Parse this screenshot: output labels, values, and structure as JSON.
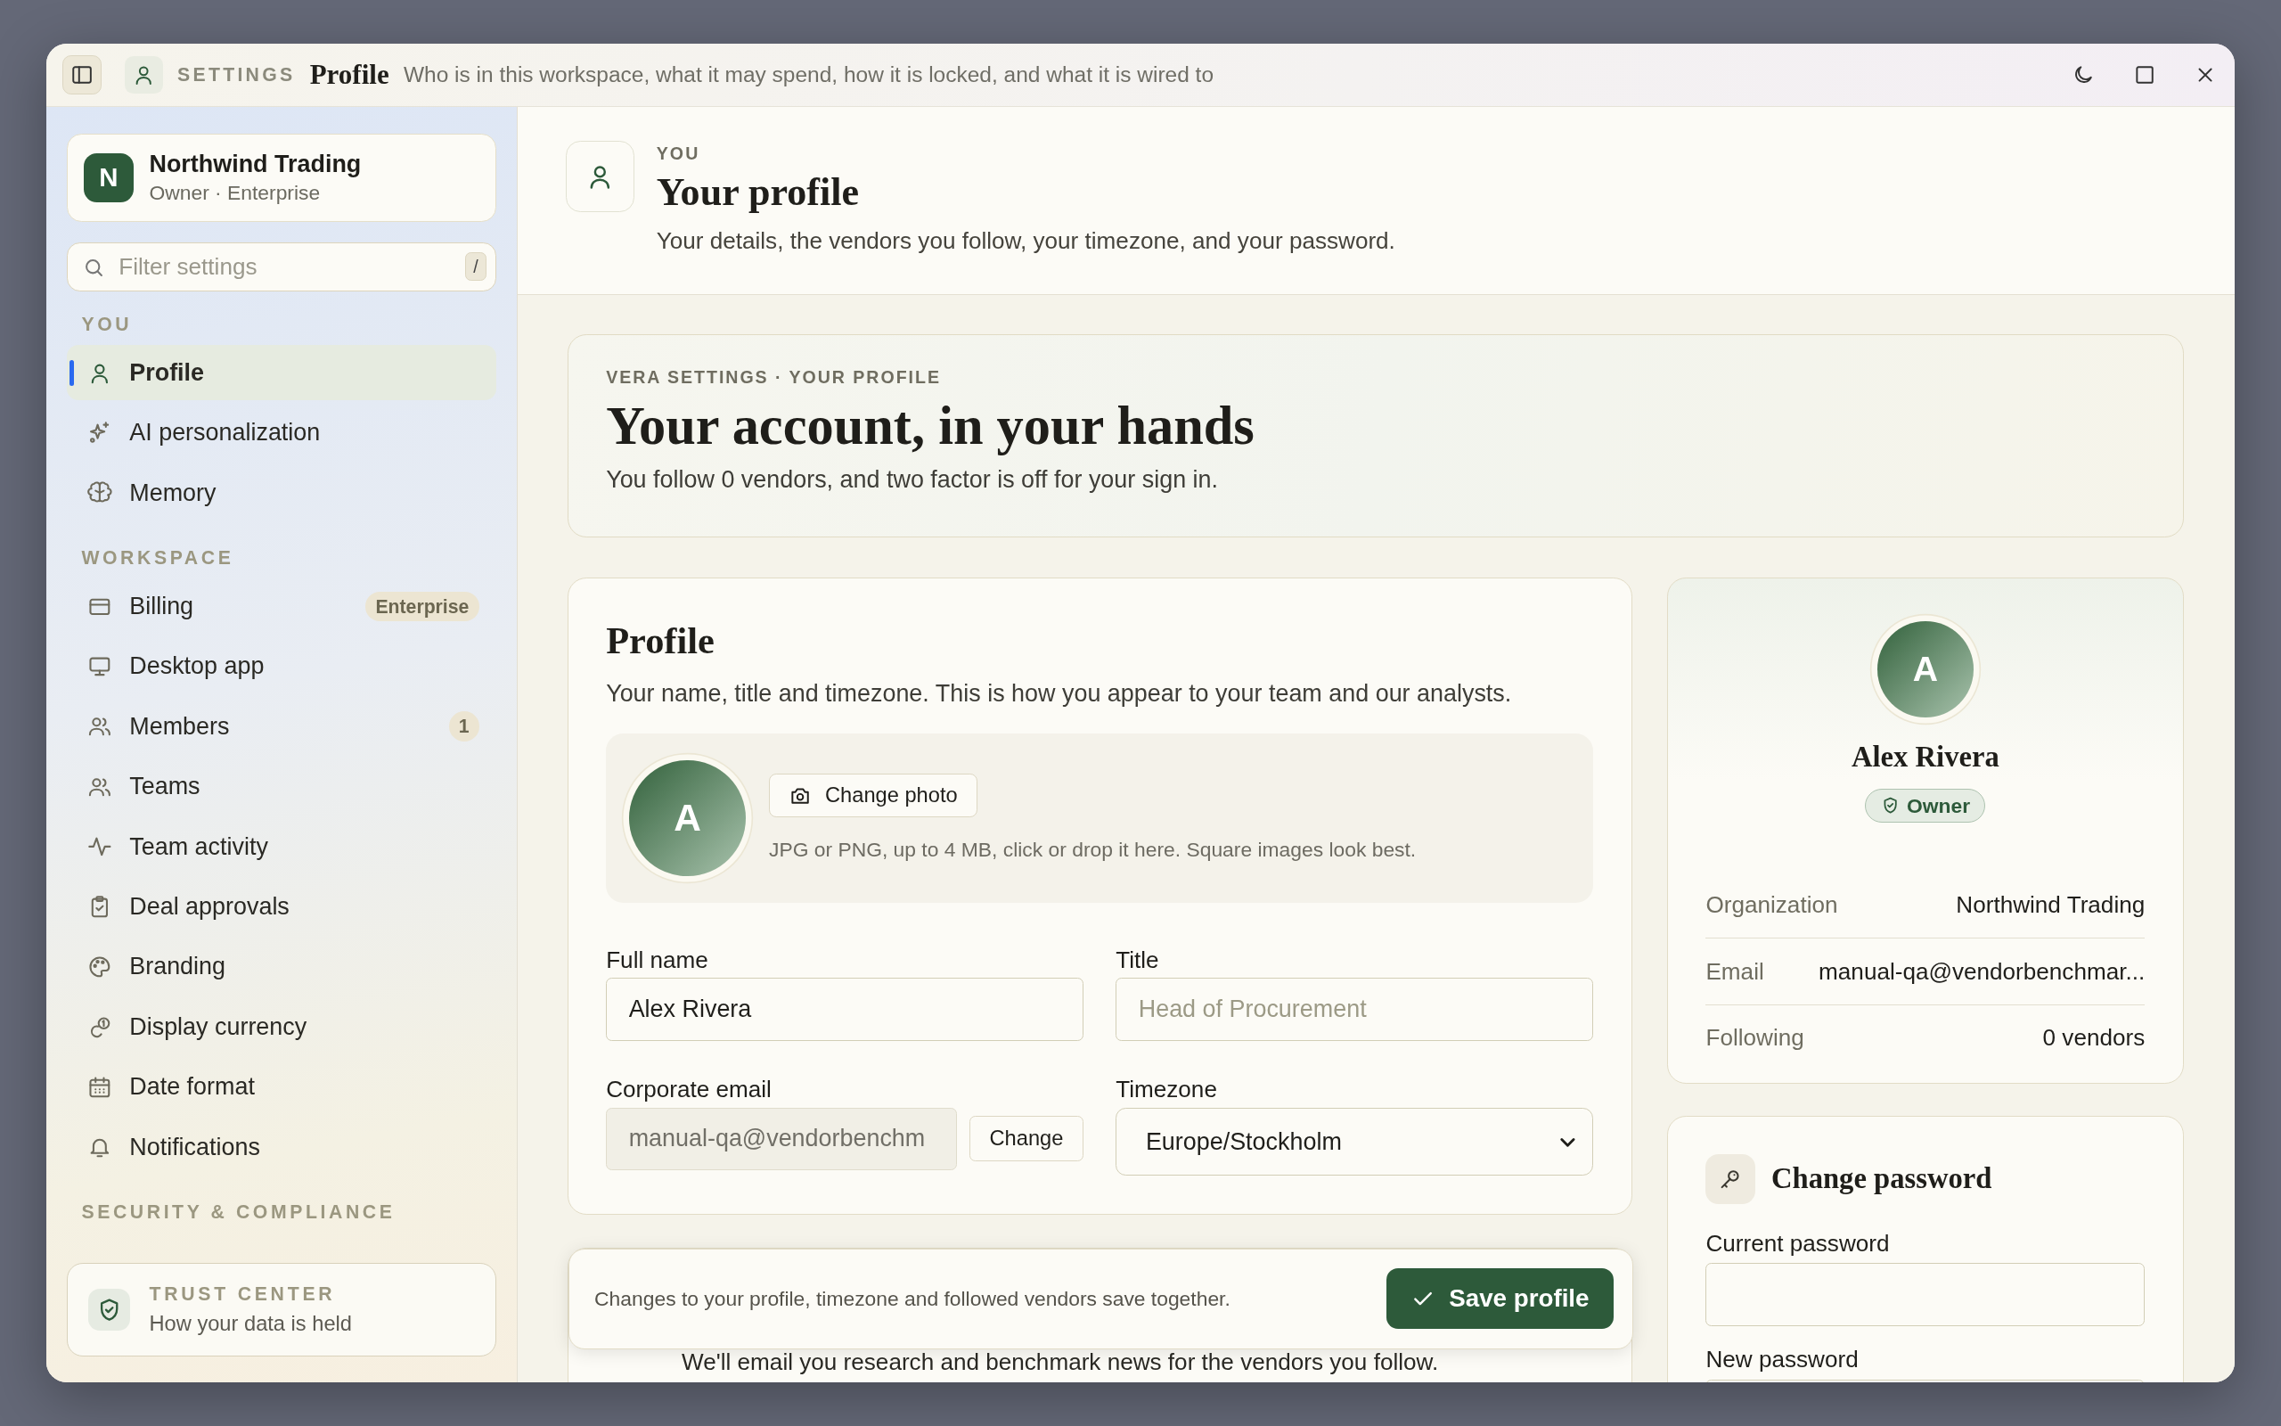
{
  "window": {
    "section": "SETTINGS",
    "title": "Profile",
    "subtitle": "Who is in this workspace, what it may spend, how it is locked, and what it is wired to"
  },
  "sidebar": {
    "org": {
      "initial": "N",
      "name": "Northwind Trading",
      "plan": "Owner · Enterprise"
    },
    "filter": {
      "placeholder": "Filter settings",
      "shortcut": "/"
    },
    "groups": [
      {
        "heading": "YOU",
        "items": [
          {
            "label": "Profile",
            "selected": true
          },
          {
            "label": "AI personalization",
            "selected": false
          },
          {
            "label": "Memory",
            "selected": false
          }
        ]
      },
      {
        "heading": "WORKSPACE",
        "items": [
          {
            "label": "Billing",
            "selected": false,
            "badge": "Enterprise"
          },
          {
            "label": "Desktop app",
            "selected": false
          },
          {
            "label": "Members",
            "selected": false,
            "badge": "1"
          },
          {
            "label": "Teams",
            "selected": false
          },
          {
            "label": "Team activity",
            "selected": false
          },
          {
            "label": "Deal approvals",
            "selected": false
          },
          {
            "label": "Branding",
            "selected": false
          },
          {
            "label": "Display currency",
            "selected": false
          },
          {
            "label": "Date format",
            "selected": false
          },
          {
            "label": "Notifications",
            "selected": false
          }
        ]
      },
      {
        "heading": "SECURITY & COMPLIANCE"
      }
    ],
    "trust_center": {
      "title": "TRUST CENTER",
      "subtitle": "How your data is held"
    }
  },
  "header": {
    "eyebrow": "YOU",
    "title": "Your profile",
    "description": "Your details, the vendors you follow, your timezone, and your password."
  },
  "hero": {
    "eyebrow": "VERA SETTINGS · YOUR PROFILE",
    "title": "Your account, in your hands",
    "text": "You follow 0 vendors, and two factor is off for your sign in."
  },
  "profile_card": {
    "title": "Profile",
    "description": "Your name, title and timezone. This is how you appear to your team and our analysts.",
    "avatar_initial": "A",
    "photo_button": "Change photo",
    "photo_hint": "JPG or PNG, up to 4 MB, click or drop it here. Square images look best.",
    "fields": [
      {
        "kind": "text",
        "label": "Full name",
        "value": "Alex Rivera",
        "disabled": false
      },
      {
        "kind": "text",
        "label": "Title",
        "placeholder": "Head of Procurement",
        "disabled": false
      },
      {
        "kind": "email",
        "label": "Corporate email",
        "value": "manual-qa@vendorbenchm",
        "disabled": true,
        "button": "Change"
      },
      {
        "kind": "select",
        "label": "Timezone",
        "value": "Europe/Stockholm",
        "disabled": false
      }
    ]
  },
  "notice_card": {
    "text": "We'll email you research and benchmark news for the vendors you follow."
  },
  "save_bar": {
    "text": "Changes to your profile, timezone and followed vendors save together.",
    "button": "Save profile"
  },
  "summary_card": {
    "initial": "A",
    "name": "Alex Rivera",
    "role": "Owner",
    "rows": [
      {
        "label": "Organization",
        "value": "Northwind Trading"
      },
      {
        "label": "Email",
        "value": "manual-qa@vendorbenchmar..."
      },
      {
        "label": "Following",
        "value": "0 vendors"
      }
    ]
  },
  "password_card": {
    "title": "Change password",
    "fields": [
      {
        "label": "Current password"
      },
      {
        "label": "New password"
      }
    ]
  }
}
